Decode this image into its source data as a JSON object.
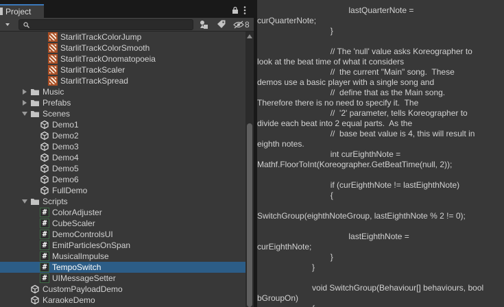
{
  "window": {
    "tab_label": "Project",
    "hidden_package_count": "8"
  },
  "search": {
    "value": "",
    "placeholder": ""
  },
  "tree": [
    {
      "label": "StarlitTrackColorJump",
      "type": "track"
    },
    {
      "label": "StarlitTrackColorSmooth",
      "type": "track"
    },
    {
      "label": "StarlitTrackOnomatopoeia",
      "type": "track"
    },
    {
      "label": "StarlitTrackScaler",
      "type": "track"
    },
    {
      "label": "StarlitTrackSpread",
      "type": "track"
    },
    {
      "label": "Music",
      "type": "folder",
      "expanded": false
    },
    {
      "label": "Prefabs",
      "type": "folder",
      "expanded": false
    },
    {
      "label": "Scenes",
      "type": "folder",
      "expanded": true
    },
    {
      "label": "Demo1",
      "type": "scene"
    },
    {
      "label": "Demo2",
      "type": "scene"
    },
    {
      "label": "Demo3",
      "type": "scene"
    },
    {
      "label": "Demo4",
      "type": "scene"
    },
    {
      "label": "Demo5",
      "type": "scene"
    },
    {
      "label": "Demo6",
      "type": "scene"
    },
    {
      "label": "FullDemo",
      "type": "scene"
    },
    {
      "label": "Scripts",
      "type": "folder",
      "expanded": true
    },
    {
      "label": "ColorAdjuster",
      "type": "script"
    },
    {
      "label": "CubeScaler",
      "type": "script"
    },
    {
      "label": "DemoControlsUI",
      "type": "script"
    },
    {
      "label": "EmitParticlesOnSpan",
      "type": "script"
    },
    {
      "label": "MusicalImpulse",
      "type": "script"
    },
    {
      "label": "TempoSwitch",
      "type": "script",
      "selected": true
    },
    {
      "label": "UIMessageSetter",
      "type": "script"
    },
    {
      "label": "CustomPayloadDemo",
      "type": "scene"
    },
    {
      "label": "KaraokeDemo",
      "type": "scene"
    }
  ],
  "code_lines": [
    "                                        lastQuarterNote =",
    "curQuarterNote;",
    "                                }",
    "",
    "                                // The 'null' value asks Koreographer to",
    "look at the beat time of what it considers",
    "                                //  the current \"Main\" song.  These",
    "demos use a basic player with a single song and",
    "                                //  define that as the Main song.",
    "Therefore there is no need to specify it.  The",
    "                                //  '2' parameter, tells Koreographer to",
    "divide each beat into 2 equal parts.  As the",
    "                                //  base beat value is 4, this will result in",
    "eighth notes.",
    "                                int curEighthNote =",
    "Mathf.FloorToInt(Koreographer.GetBeatTime(null, 2));",
    "",
    "                                if (curEighthNote != lastEighthNote)",
    "                                {",
    "",
    "SwitchGroup(eighthNoteGroup, lastEighthNote % 2 != 0);",
    "",
    "                                        lastEighthNote =",
    "curEighthNote;",
    "                                }",
    "                        }",
    "",
    "                        void SwitchGroup(Behaviour[] behaviours, bool",
    "bGroupOn)",
    "                        {"
  ],
  "colors": {
    "selection": "#2c5d87",
    "tab_accent": "#3a79bb",
    "folder": "#c4c4c4",
    "script_badge_border": "#3f6b46",
    "track_icon": "#a94e25"
  }
}
